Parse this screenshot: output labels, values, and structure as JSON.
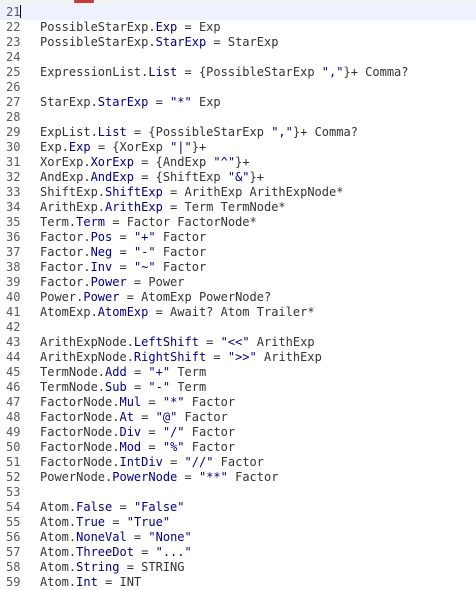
{
  "editor": {
    "current_line": 21,
    "lines": [
      {
        "n": "21",
        "tokens": []
      },
      {
        "n": "22",
        "tokens": [
          {
            "t": "PossibleStarExp.",
            "c": "ref"
          },
          {
            "t": "Exp",
            "c": "kw"
          },
          {
            "t": " = Exp",
            "c": "op"
          }
        ]
      },
      {
        "n": "23",
        "tokens": [
          {
            "t": "PossibleStarExp.",
            "c": "ref"
          },
          {
            "t": "StarExp",
            "c": "kw"
          },
          {
            "t": " = StarExp",
            "c": "op"
          }
        ]
      },
      {
        "n": "24",
        "tokens": []
      },
      {
        "n": "25",
        "tokens": [
          {
            "t": "ExpressionList.",
            "c": "ref"
          },
          {
            "t": "List",
            "c": "kw"
          },
          {
            "t": " = {PossibleStarExp ",
            "c": "op"
          },
          {
            "t": "\",\"",
            "c": "str"
          },
          {
            "t": "}+ Comma?",
            "c": "op"
          }
        ]
      },
      {
        "n": "26",
        "tokens": []
      },
      {
        "n": "27",
        "tokens": [
          {
            "t": "StarExp.",
            "c": "ref"
          },
          {
            "t": "StarExp",
            "c": "kw"
          },
          {
            "t": " = ",
            "c": "op"
          },
          {
            "t": "\"*\"",
            "c": "str"
          },
          {
            "t": " Exp",
            "c": "op"
          }
        ]
      },
      {
        "n": "28",
        "tokens": []
      },
      {
        "n": "29",
        "tokens": [
          {
            "t": "ExpList.",
            "c": "ref"
          },
          {
            "t": "List",
            "c": "kw"
          },
          {
            "t": " = {PossibleStarExp ",
            "c": "op"
          },
          {
            "t": "\",\"",
            "c": "str"
          },
          {
            "t": "}+ Comma?",
            "c": "op"
          }
        ]
      },
      {
        "n": "30",
        "tokens": [
          {
            "t": "Exp.",
            "c": "ref"
          },
          {
            "t": "Exp",
            "c": "kw"
          },
          {
            "t": " = {XorExp ",
            "c": "op"
          },
          {
            "t": "\"|\"",
            "c": "str"
          },
          {
            "t": "}+",
            "c": "op"
          }
        ]
      },
      {
        "n": "31",
        "tokens": [
          {
            "t": "XorExp.",
            "c": "ref"
          },
          {
            "t": "XorExp",
            "c": "kw"
          },
          {
            "t": " = {AndExp ",
            "c": "op"
          },
          {
            "t": "\"^\"",
            "c": "str"
          },
          {
            "t": "}+",
            "c": "op"
          }
        ]
      },
      {
        "n": "32",
        "tokens": [
          {
            "t": "AndExp.",
            "c": "ref"
          },
          {
            "t": "AndExp",
            "c": "kw"
          },
          {
            "t": " = {ShiftExp ",
            "c": "op"
          },
          {
            "t": "\"&\"",
            "c": "str"
          },
          {
            "t": "}+",
            "c": "op"
          }
        ]
      },
      {
        "n": "33",
        "tokens": [
          {
            "t": "ShiftExp.",
            "c": "ref"
          },
          {
            "t": "ShiftExp",
            "c": "kw"
          },
          {
            "t": " = ArithExp ArithExpNode*",
            "c": "op"
          }
        ]
      },
      {
        "n": "34",
        "tokens": [
          {
            "t": "ArithExp.",
            "c": "ref"
          },
          {
            "t": "ArithExp",
            "c": "kw"
          },
          {
            "t": " = Term TermNode*",
            "c": "op"
          }
        ]
      },
      {
        "n": "35",
        "tokens": [
          {
            "t": "Term.",
            "c": "ref"
          },
          {
            "t": "Term",
            "c": "kw"
          },
          {
            "t": " = Factor FactorNode*",
            "c": "op"
          }
        ]
      },
      {
        "n": "36",
        "tokens": [
          {
            "t": "Factor.",
            "c": "ref"
          },
          {
            "t": "Pos",
            "c": "kw"
          },
          {
            "t": " = ",
            "c": "op"
          },
          {
            "t": "\"+\"",
            "c": "str"
          },
          {
            "t": " Factor",
            "c": "op"
          }
        ]
      },
      {
        "n": "37",
        "tokens": [
          {
            "t": "Factor.",
            "c": "ref"
          },
          {
            "t": "Neg",
            "c": "kw"
          },
          {
            "t": " = ",
            "c": "op"
          },
          {
            "t": "\"-\"",
            "c": "str"
          },
          {
            "t": " Factor",
            "c": "op"
          }
        ]
      },
      {
        "n": "38",
        "tokens": [
          {
            "t": "Factor.",
            "c": "ref"
          },
          {
            "t": "Inv",
            "c": "kw"
          },
          {
            "t": " = ",
            "c": "op"
          },
          {
            "t": "\"~\"",
            "c": "str"
          },
          {
            "t": " Factor",
            "c": "op"
          }
        ]
      },
      {
        "n": "39",
        "tokens": [
          {
            "t": "Factor.",
            "c": "ref"
          },
          {
            "t": "Power",
            "c": "kw"
          },
          {
            "t": " = Power",
            "c": "op"
          }
        ]
      },
      {
        "n": "40",
        "tokens": [
          {
            "t": "Power.",
            "c": "ref"
          },
          {
            "t": "Power",
            "c": "kw"
          },
          {
            "t": " = AtomExp PowerNode?",
            "c": "op"
          }
        ]
      },
      {
        "n": "41",
        "tokens": [
          {
            "t": "AtomExp.",
            "c": "ref"
          },
          {
            "t": "AtomExp",
            "c": "kw"
          },
          {
            "t": " = Await? Atom Trailer*",
            "c": "op"
          }
        ]
      },
      {
        "n": "42",
        "tokens": []
      },
      {
        "n": "43",
        "tokens": [
          {
            "t": "ArithExpNode.",
            "c": "ref"
          },
          {
            "t": "LeftShift",
            "c": "kw"
          },
          {
            "t": " = ",
            "c": "op"
          },
          {
            "t": "\"<<\"",
            "c": "str"
          },
          {
            "t": " ArithExp",
            "c": "op"
          }
        ]
      },
      {
        "n": "44",
        "tokens": [
          {
            "t": "ArithExpNode.",
            "c": "ref"
          },
          {
            "t": "RightShift",
            "c": "kw"
          },
          {
            "t": " = ",
            "c": "op"
          },
          {
            "t": "\">>\"",
            "c": "str"
          },
          {
            "t": " ArithExp",
            "c": "op"
          }
        ]
      },
      {
        "n": "45",
        "tokens": [
          {
            "t": "TermNode.",
            "c": "ref"
          },
          {
            "t": "Add",
            "c": "kw"
          },
          {
            "t": " = ",
            "c": "op"
          },
          {
            "t": "\"+\"",
            "c": "str"
          },
          {
            "t": " Term",
            "c": "op"
          }
        ]
      },
      {
        "n": "46",
        "tokens": [
          {
            "t": "TermNode.",
            "c": "ref"
          },
          {
            "t": "Sub",
            "c": "kw"
          },
          {
            "t": " = ",
            "c": "op"
          },
          {
            "t": "\"-\"",
            "c": "str"
          },
          {
            "t": " Term",
            "c": "op"
          }
        ]
      },
      {
        "n": "47",
        "tokens": [
          {
            "t": "FactorNode.",
            "c": "ref"
          },
          {
            "t": "Mul",
            "c": "kw"
          },
          {
            "t": " = ",
            "c": "op"
          },
          {
            "t": "\"*\"",
            "c": "str"
          },
          {
            "t": " Factor",
            "c": "op"
          }
        ]
      },
      {
        "n": "48",
        "tokens": [
          {
            "t": "FactorNode.",
            "c": "ref"
          },
          {
            "t": "At",
            "c": "kw"
          },
          {
            "t": " = ",
            "c": "op"
          },
          {
            "t": "\"@\"",
            "c": "str"
          },
          {
            "t": " Factor",
            "c": "op"
          }
        ]
      },
      {
        "n": "49",
        "tokens": [
          {
            "t": "FactorNode.",
            "c": "ref"
          },
          {
            "t": "Div",
            "c": "kw"
          },
          {
            "t": " = ",
            "c": "op"
          },
          {
            "t": "\"/\"",
            "c": "str"
          },
          {
            "t": " Factor",
            "c": "op"
          }
        ]
      },
      {
        "n": "50",
        "tokens": [
          {
            "t": "FactorNode.",
            "c": "ref"
          },
          {
            "t": "Mod",
            "c": "kw"
          },
          {
            "t": " = ",
            "c": "op"
          },
          {
            "t": "\"%\"",
            "c": "str"
          },
          {
            "t": " Factor",
            "c": "op"
          }
        ]
      },
      {
        "n": "51",
        "tokens": [
          {
            "t": "FactorNode.",
            "c": "ref"
          },
          {
            "t": "IntDiv",
            "c": "kw"
          },
          {
            "t": " = ",
            "c": "op"
          },
          {
            "t": "\"//\"",
            "c": "str"
          },
          {
            "t": " Factor",
            "c": "op"
          }
        ]
      },
      {
        "n": "52",
        "tokens": [
          {
            "t": "PowerNode.",
            "c": "ref"
          },
          {
            "t": "PowerNode",
            "c": "kw"
          },
          {
            "t": " = ",
            "c": "op"
          },
          {
            "t": "\"**\"",
            "c": "str"
          },
          {
            "t": " Factor",
            "c": "op"
          }
        ]
      },
      {
        "n": "53",
        "tokens": []
      },
      {
        "n": "54",
        "tokens": [
          {
            "t": "Atom.",
            "c": "ref"
          },
          {
            "t": "False",
            "c": "kw"
          },
          {
            "t": " = ",
            "c": "op"
          },
          {
            "t": "\"False\"",
            "c": "str"
          }
        ]
      },
      {
        "n": "55",
        "tokens": [
          {
            "t": "Atom.",
            "c": "ref"
          },
          {
            "t": "True",
            "c": "kw"
          },
          {
            "t": " = ",
            "c": "op"
          },
          {
            "t": "\"True\"",
            "c": "str"
          }
        ]
      },
      {
        "n": "56",
        "tokens": [
          {
            "t": "Atom.",
            "c": "ref"
          },
          {
            "t": "NoneVal",
            "c": "kw"
          },
          {
            "t": " = ",
            "c": "op"
          },
          {
            "t": "\"None\"",
            "c": "str"
          }
        ]
      },
      {
        "n": "57",
        "tokens": [
          {
            "t": "Atom.",
            "c": "ref"
          },
          {
            "t": "ThreeDot",
            "c": "kw"
          },
          {
            "t": " = ",
            "c": "op"
          },
          {
            "t": "\"...\"",
            "c": "str"
          }
        ]
      },
      {
        "n": "58",
        "tokens": [
          {
            "t": "Atom.",
            "c": "ref"
          },
          {
            "t": "String",
            "c": "kw"
          },
          {
            "t": " = STRING",
            "c": "op"
          }
        ]
      },
      {
        "n": "59",
        "tokens": [
          {
            "t": "Atom.",
            "c": "ref"
          },
          {
            "t": "Int",
            "c": "kw"
          },
          {
            "t": " = INT",
            "c": "op"
          }
        ]
      }
    ]
  },
  "colors": {
    "background": "#ffffff",
    "keyword": "#000080",
    "string": "#000080",
    "text": "#333333",
    "gutter_text": "#555a66",
    "current_line_bg": "#eef1ff",
    "scroll_marker": "#c43b3b"
  }
}
